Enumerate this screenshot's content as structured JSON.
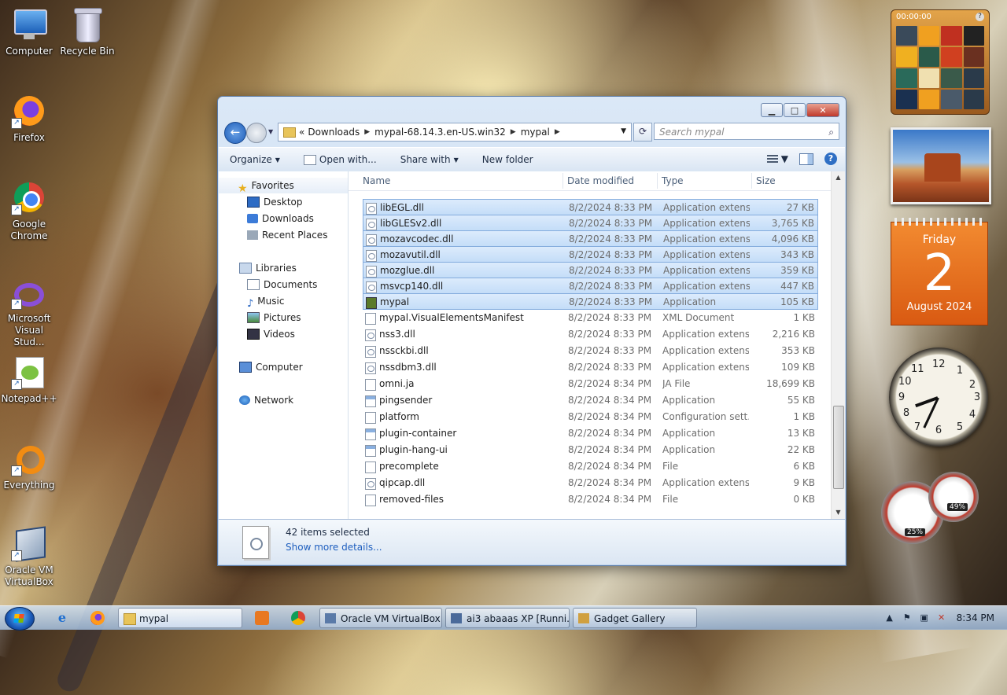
{
  "desktop_icons": [
    {
      "label": "Computer",
      "icon": "computer-icon"
    },
    {
      "label": "Recycle Bin",
      "icon": "recycle-bin-icon"
    },
    {
      "label": "Firefox",
      "icon": "firefox-icon"
    },
    {
      "label": "Google Chrome",
      "icon": "chrome-icon"
    },
    {
      "label": "Microsoft Visual Stud...",
      "icon": "visual-studio-icon"
    },
    {
      "label": "Notepad++",
      "icon": "notepad-plus-plus-icon"
    },
    {
      "label": "Everything",
      "icon": "everything-icon"
    },
    {
      "label": "Oracle VM VirtualBox",
      "icon": "virtualbox-icon"
    }
  ],
  "gadgets": {
    "puzzle_timer": "00:00:00",
    "calendar": {
      "weekday": "Friday",
      "day": "2",
      "month_year": "August 2024"
    },
    "clock_numbers": [
      "12",
      "1",
      "2",
      "3",
      "4",
      "5",
      "6",
      "7",
      "8",
      "9",
      "10",
      "11"
    ],
    "cpu_meter": {
      "cpu": "25%",
      "memory": "49%"
    }
  },
  "window": {
    "address": {
      "prefix": "«",
      "segments": [
        "Downloads",
        "mypal-68.14.3.en-US.win32",
        "mypal"
      ]
    },
    "search_placeholder": "Search mypal",
    "toolbar": {
      "organize": "Organize",
      "open_with": "Open with...",
      "share_with": "Share with",
      "new_folder": "New folder"
    },
    "nav": {
      "favorites": "Favorites",
      "desktop": "Desktop",
      "downloads": "Downloads",
      "recent_places": "Recent Places",
      "libraries": "Libraries",
      "documents": "Documents",
      "music": "Music",
      "pictures": "Pictures",
      "videos": "Videos",
      "computer": "Computer",
      "network": "Network"
    },
    "columns": {
      "name": "Name",
      "date": "Date modified",
      "type": "Type",
      "size": "Size"
    },
    "files": [
      {
        "name": "libEGL.dll",
        "date": "8/2/2024 8:33 PM",
        "type": "Application extens...",
        "size": "27 KB",
        "selected": true,
        "kind": "dll"
      },
      {
        "name": "libGLESv2.dll",
        "date": "8/2/2024 8:33 PM",
        "type": "Application extens...",
        "size": "3,765 KB",
        "selected": true,
        "kind": "dll"
      },
      {
        "name": "mozavcodec.dll",
        "date": "8/2/2024 8:33 PM",
        "type": "Application extens...",
        "size": "4,096 KB",
        "selected": true,
        "kind": "dll"
      },
      {
        "name": "mozavutil.dll",
        "date": "8/2/2024 8:33 PM",
        "type": "Application extens...",
        "size": "343 KB",
        "selected": true,
        "kind": "dll"
      },
      {
        "name": "mozglue.dll",
        "date": "8/2/2024 8:33 PM",
        "type": "Application extens...",
        "size": "359 KB",
        "selected": true,
        "kind": "dll"
      },
      {
        "name": "msvcp140.dll",
        "date": "8/2/2024 8:33 PM",
        "type": "Application extens...",
        "size": "447 KB",
        "selected": true,
        "kind": "dll"
      },
      {
        "name": "mypal",
        "date": "8/2/2024 8:33 PM",
        "type": "Application",
        "size": "105 KB",
        "selected": true,
        "kind": "mp"
      },
      {
        "name": "mypal.VisualElementsManifest",
        "date": "8/2/2024 8:33 PM",
        "type": "XML Document",
        "size": "1 KB",
        "selected": false,
        "kind": "file"
      },
      {
        "name": "nss3.dll",
        "date": "8/2/2024 8:33 PM",
        "type": "Application extens...",
        "size": "2,216 KB",
        "selected": false,
        "kind": "dll"
      },
      {
        "name": "nssckbi.dll",
        "date": "8/2/2024 8:33 PM",
        "type": "Application extens...",
        "size": "353 KB",
        "selected": false,
        "kind": "dll"
      },
      {
        "name": "nssdbm3.dll",
        "date": "8/2/2024 8:33 PM",
        "type": "Application extens...",
        "size": "109 KB",
        "selected": false,
        "kind": "dll"
      },
      {
        "name": "omni.ja",
        "date": "8/2/2024 8:34 PM",
        "type": "JA File",
        "size": "18,699 KB",
        "selected": false,
        "kind": "file"
      },
      {
        "name": "pingsender",
        "date": "8/2/2024 8:34 PM",
        "type": "Application",
        "size": "55 KB",
        "selected": false,
        "kind": "app"
      },
      {
        "name": "platform",
        "date": "8/2/2024 8:34 PM",
        "type": "Configuration sett...",
        "size": "1 KB",
        "selected": false,
        "kind": "file"
      },
      {
        "name": "plugin-container",
        "date": "8/2/2024 8:34 PM",
        "type": "Application",
        "size": "13 KB",
        "selected": false,
        "kind": "app"
      },
      {
        "name": "plugin-hang-ui",
        "date": "8/2/2024 8:34 PM",
        "type": "Application",
        "size": "22 KB",
        "selected": false,
        "kind": "app"
      },
      {
        "name": "precomplete",
        "date": "8/2/2024 8:34 PM",
        "type": "File",
        "size": "6 KB",
        "selected": false,
        "kind": "file"
      },
      {
        "name": "qipcap.dll",
        "date": "8/2/2024 8:34 PM",
        "type": "Application extens...",
        "size": "9 KB",
        "selected": false,
        "kind": "dll"
      },
      {
        "name": "removed-files",
        "date": "8/2/2024 8:34 PM",
        "type": "File",
        "size": "0 KB",
        "selected": false,
        "kind": "file"
      }
    ],
    "details": {
      "count": "42 items selected",
      "more": "Show more details..."
    }
  },
  "taskbar": {
    "buttons": [
      "mypal",
      "Oracle VM VirtualBox...",
      "ai3 abaaas XP [Runni...",
      "Gadget Gallery"
    ],
    "time": "8:34 PM"
  }
}
